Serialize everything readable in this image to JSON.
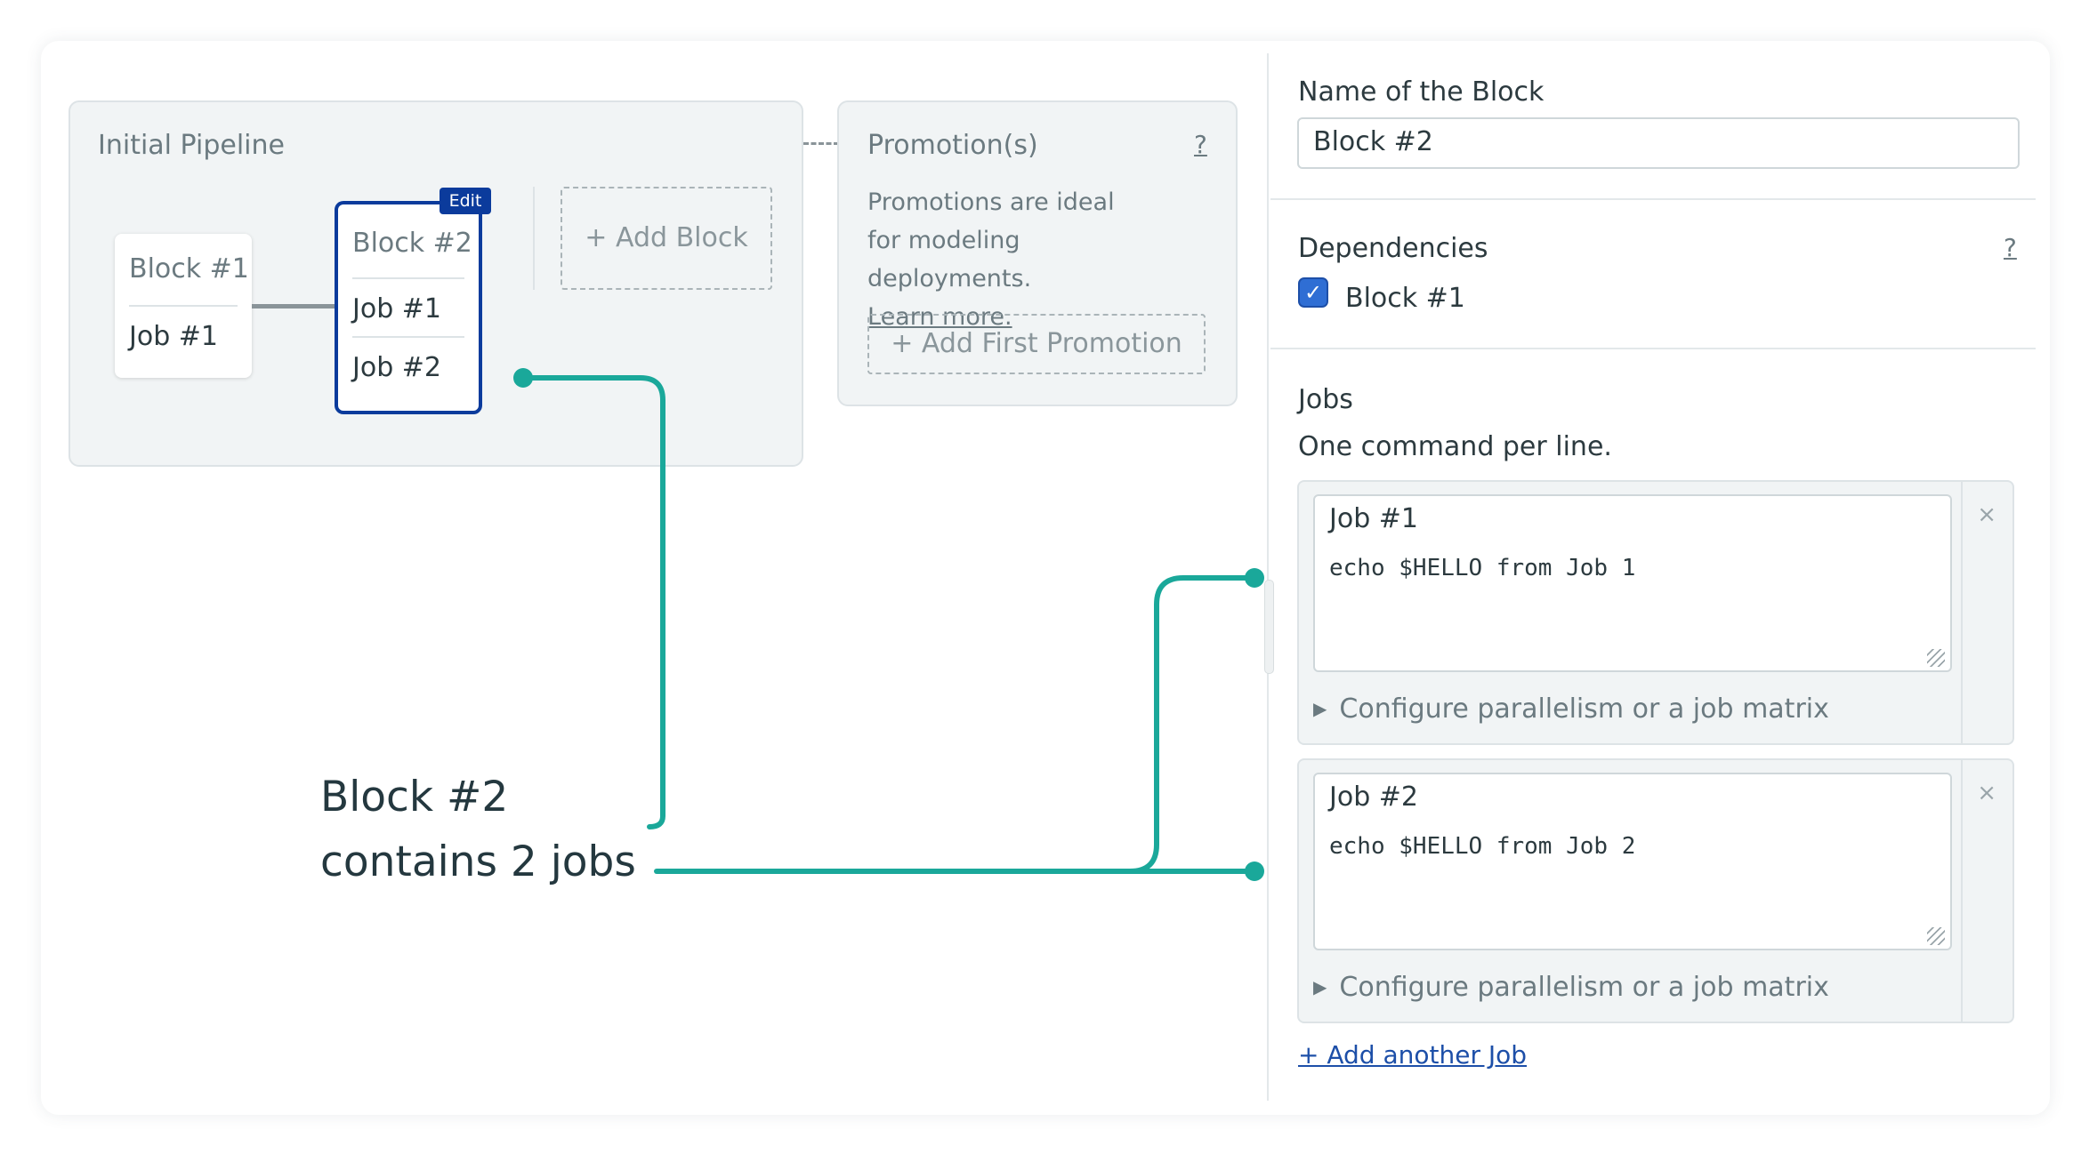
{
  "colors": {
    "accent": "#0b3b9c",
    "annotation": "#1aa89a",
    "link": "#1d4fa8",
    "canvas_bg": "#f1f4f5"
  },
  "pipeline": {
    "title": "Initial Pipeline",
    "block1": {
      "title": "Block #1",
      "jobs": [
        "Job #1"
      ]
    },
    "block2": {
      "title": "Block #2",
      "edit_badge": "Edit",
      "jobs": [
        "Job #1",
        "Job #2"
      ]
    },
    "add_block": "+ Add Block"
  },
  "promotions": {
    "title": "Promotion(s)",
    "help": "?",
    "description": "Promotions are ideal for modeling deployments.",
    "learn_more": "Learn more.",
    "add_first": "+ Add First Promotion"
  },
  "panel": {
    "name_label": "Name of the Block",
    "name_value": "Block #2",
    "dependencies_label": "Dependencies",
    "dependencies_help": "?",
    "dependencies": [
      {
        "label": "Block #1",
        "checked": true
      }
    ],
    "jobs_label": "Jobs",
    "jobs_hint": "One command per line.",
    "jobs": [
      {
        "name": "Job #1",
        "command": "echo $HELLO from Job 1",
        "parallelism": "Configure parallelism or a job matrix",
        "close": "×"
      },
      {
        "name": "Job #2",
        "command": "echo $HELLO from Job 2",
        "parallelism": "Configure parallelism or a job matrix",
        "close": "×"
      }
    ],
    "add_job": "+ Add another Job"
  },
  "annotation": {
    "line1": "Block #2",
    "line2": "contains 2 jobs"
  }
}
